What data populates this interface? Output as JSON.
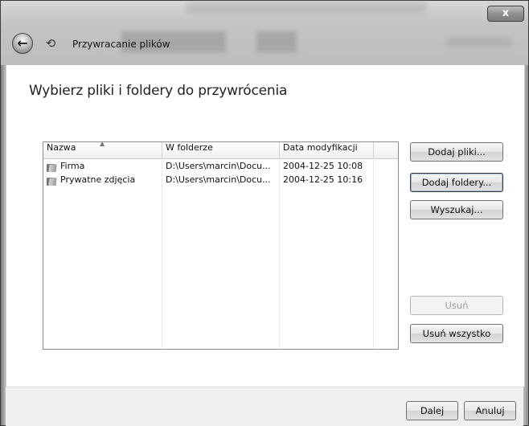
{
  "window": {
    "title": "Przywracanie plików",
    "close_glyph": "x",
    "back_glyph": "←",
    "app_icon": "restore-files-icon"
  },
  "main": {
    "heading": "Wybierz pliki i foldery do przywrócenia"
  },
  "table": {
    "columns": [
      "Nazwa",
      "W folderze",
      "Data modyfikacji"
    ],
    "rows": [
      {
        "name": "Firma",
        "folder": "D:\\Users\\marcin\\Docu...",
        "date": "2004-12-25 10:08",
        "icon": "folder-icon"
      },
      {
        "name": "Prywatne zdjęcia",
        "folder": "D:\\Users\\marcin\\Docu...",
        "date": "2004-12-25 10:16",
        "icon": "folder-icon"
      }
    ]
  },
  "side_buttons": {
    "add_files": "Dodaj pliki...",
    "add_folders": "Dodaj foldery...",
    "search": "Wyszukaj...",
    "remove": "Usuń",
    "remove_all": "Usuń wszystko"
  },
  "footer": {
    "next": "Dalej",
    "cancel": "Anuluj"
  }
}
